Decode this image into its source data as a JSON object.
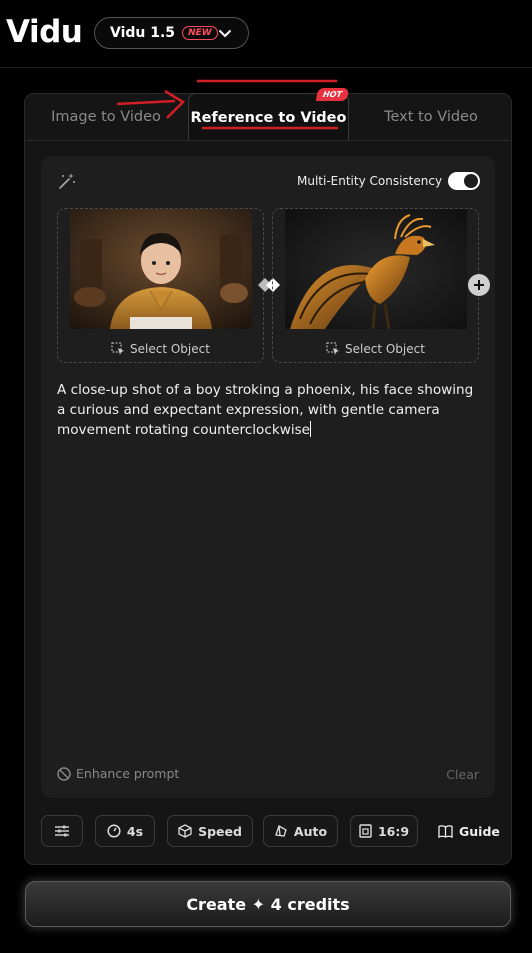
{
  "header": {
    "logo": "Vidu",
    "model": "Vidu 1.5",
    "model_badge": "NEW"
  },
  "tabs": [
    {
      "label": "Image to Video"
    },
    {
      "label": "Reference to Video",
      "badge": "HOT"
    },
    {
      "label": "Text to Video"
    }
  ],
  "editor": {
    "toggle_label": "Multi-Entity Consistency",
    "toggle_on": true,
    "references": [
      {
        "select_label": "Select Object"
      },
      {
        "select_label": "Select Object"
      }
    ],
    "prompt": "A close-up shot of a boy stroking a phoenix, his face showing a curious and expectant expression, with gentle camera movement rotating counterclockwise",
    "enhance_label": "Enhance prompt",
    "clear_label": "Clear"
  },
  "toolbar": {
    "duration": "4s",
    "speed": "Speed",
    "movement": "Auto",
    "ratio": "16:9",
    "guide": "Guide"
  },
  "create_label": "Create ✦ 4 credits",
  "colors": {
    "background": "#000000",
    "panel": "#151515",
    "accent_red": "#e8313e"
  }
}
